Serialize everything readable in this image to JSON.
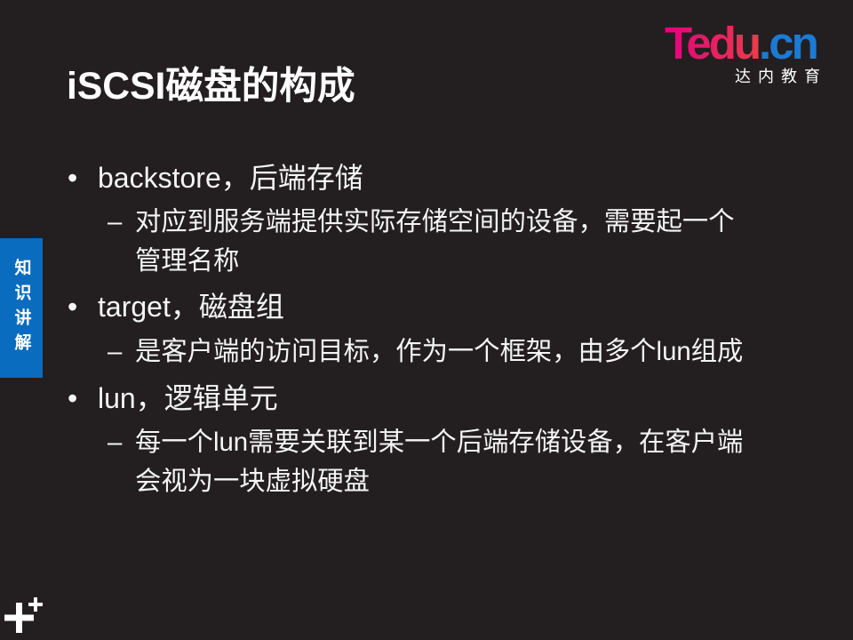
{
  "slide": {
    "title": "iSCSI磁盘的构成"
  },
  "logo": {
    "wordmark_main": "Tedu",
    "wordmark_suffix": ".cn",
    "tagline": "达内教育"
  },
  "side_tab": {
    "label": "知识讲解"
  },
  "markers": {
    "bullet": "•",
    "dash": "–"
  },
  "bullets": [
    {
      "text": "backstore，后端存储",
      "detail": [
        "对应到服务端提供实际存储空间的设备，需要起一个",
        "管理名称"
      ]
    },
    {
      "text": "target，磁盘组",
      "detail": [
        "是客户端的访问目标，作为一个框架，由多个lun组成"
      ]
    },
    {
      "text": "lun，逻辑单元",
      "detail": [
        "每一个lun需要关联到某一个后端存储设备，在客户端",
        "会视为一块虚拟硬盘"
      ]
    }
  ],
  "icons": {
    "corner_mark": "plus-icon"
  },
  "colors": {
    "background": "#231f20",
    "text": "#f5f5f5",
    "title": "#ffffff",
    "side_tab": "#0a6cbf",
    "logo_gradient_start": "#e4007f",
    "logo_gradient_end": "#ea3c4a",
    "logo_suffix": "#1c7ad4"
  }
}
